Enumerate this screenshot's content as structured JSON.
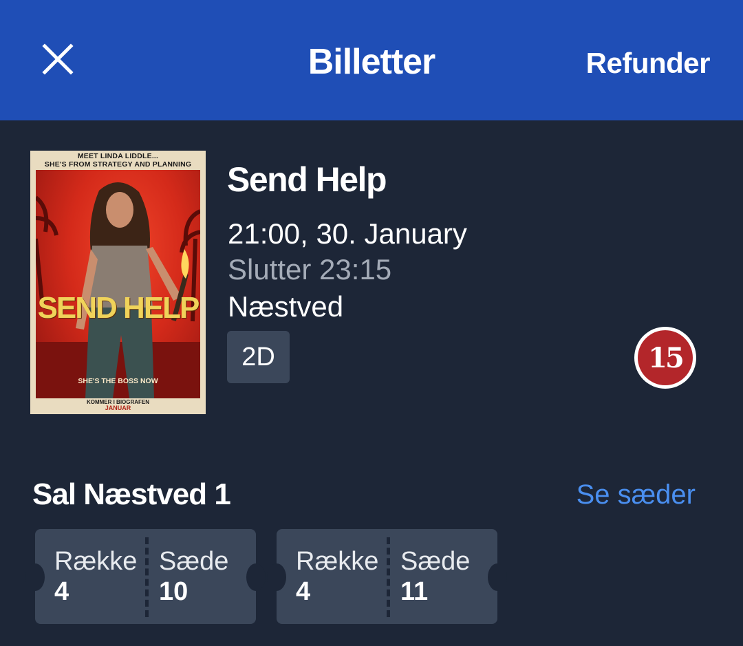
{
  "header": {
    "title": "Billetter",
    "refund_label": "Refunder",
    "close_icon": "close-icon",
    "background_color": "#1f4eb6"
  },
  "movie": {
    "title": "Send Help",
    "datetime": "21:00, 30. January",
    "ends": "Slutter 23:15",
    "location": "Næstved",
    "format": "2D",
    "age_rating": "15",
    "poster": {
      "tagline_1": "MEET LINDA LIDDLE...",
      "tagline_2": "SHE'S FROM STRATEGY AND PLANNING",
      "title": "SEND HELP",
      "bottom_line": "SHE'S THE BOSS NOW",
      "coming": "KOMMER I BIOGRAFEN",
      "coming_month": "JANUAR"
    }
  },
  "hall": {
    "name": "Sal Næstved 1",
    "see_seats_label": "Se sæder"
  },
  "tickets": [
    {
      "row_label": "Række",
      "row": "4",
      "seat_label": "Sæde",
      "seat": "10"
    },
    {
      "row_label": "Række",
      "row": "4",
      "seat_label": "Sæde",
      "seat": "11"
    }
  ],
  "colors": {
    "background": "#1d2637",
    "ticket": "#3b475a",
    "link": "#4a8ff0",
    "muted_text": "#a4abb7",
    "rating_red": "#b3262a"
  }
}
